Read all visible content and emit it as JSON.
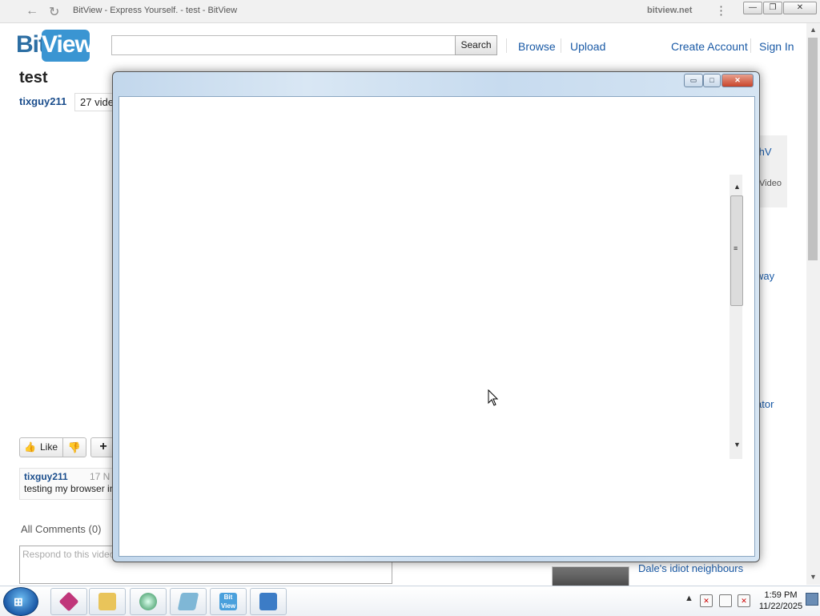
{
  "browser": {
    "back_glyph": "←",
    "reload_glyph": "↻",
    "window_title": "BitView - Express Yourself. - test - BitView",
    "domain": "bitview.net",
    "menu_glyph": "⋮",
    "minimize_glyph": "—",
    "maximize_glyph": "❐",
    "close_glyph": "✕"
  },
  "site": {
    "logo_bit": "Bit",
    "logo_view": "View",
    "search_placeholder": "",
    "search_button": "Search",
    "nav": {
      "browse": "Browse",
      "upload": "Upload",
      "create_account": "Create Account",
      "sign_in": "Sign In"
    }
  },
  "video": {
    "title": "test",
    "uploader": "tixguy211",
    "video_count": "27 vide",
    "like_label": "Like",
    "like_icon": "👍",
    "dislike_icon": "👎",
    "add_glyph": "+",
    "description": {
      "user": "tixguy211",
      "date": "17 N",
      "text": "testing my browser in"
    }
  },
  "comments": {
    "title": "All Comments (0)",
    "placeholder": "Respond to this video"
  },
  "sidebar": {
    "item1_title": "thV",
    "item1_meta": "Video",
    "item2_title": "way",
    "item3_title": "ator",
    "item4_title": "Dale's idiot neighbours"
  },
  "popup": {
    "minimize_glyph": "▭",
    "maximize_glyph": "□",
    "close_glyph": "✕",
    "scroll_up": "▲",
    "scroll_down": "▼",
    "grip": "≡"
  },
  "taskbar": {
    "start_glyph": "⊞",
    "tray_expand": "▲",
    "time": "1:59 PM",
    "date": "11/22/2025",
    "apps": [
      {
        "name": "media-app",
        "color": "#c0367a"
      },
      {
        "name": "explorer",
        "color": "#e9c45a"
      },
      {
        "name": "browser",
        "color": "#2f8f57"
      },
      {
        "name": "notepad",
        "color": "#7fb7d6"
      },
      {
        "name": "bitview",
        "color": "#4aa0dc"
      },
      {
        "name": "control-panel",
        "color": "#3c7cc6"
      }
    ],
    "app_bitview_label": "Bit View"
  }
}
